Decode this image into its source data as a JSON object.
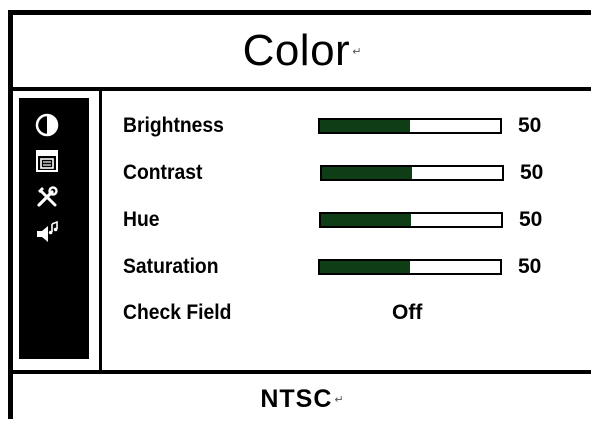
{
  "title": "Color",
  "paragraph_mark": "↵",
  "sidebar": {
    "items": [
      {
        "icon": "contrast-circle-icon"
      },
      {
        "icon": "picture-window-icon"
      },
      {
        "icon": "tools-icon"
      },
      {
        "icon": "speaker-music-icon"
      }
    ]
  },
  "settings": [
    {
      "label": "Brightness",
      "value": "50",
      "level": 0.5
    },
    {
      "label": "Contrast",
      "value": "50",
      "level": 0.5
    },
    {
      "label": "Hue",
      "value": "50",
      "level": 0.5
    },
    {
      "label": "Saturation",
      "value": "50",
      "level": 0.5
    },
    {
      "label": "Check Field",
      "value": "Off"
    }
  ],
  "footer": {
    "signal": "NTSC"
  },
  "colors": {
    "slider_fill": "#0f3d16",
    "frame": "#000000",
    "background": "#ffffff"
  }
}
